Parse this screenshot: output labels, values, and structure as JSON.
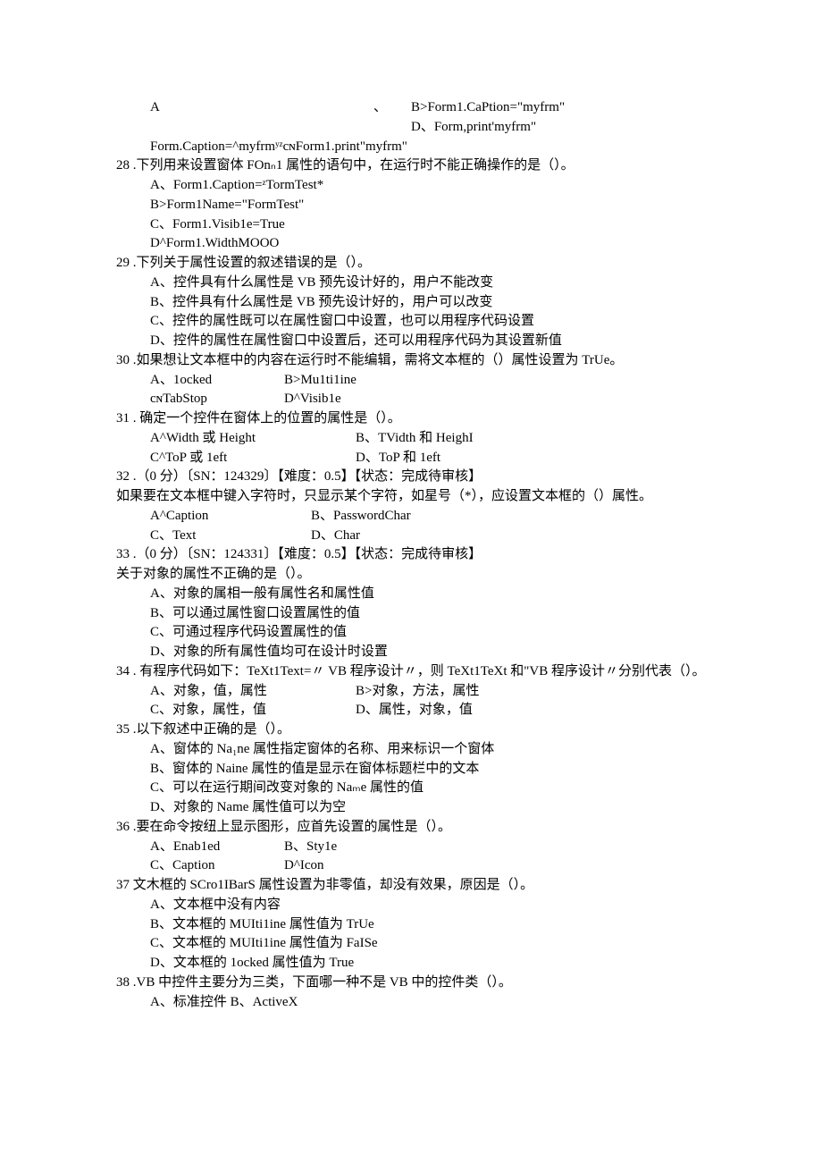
{
  "q27_frag": {
    "A": "A",
    "sep": "、",
    "B": "B>Form1.CaPtion=\"myfrm\"",
    "D": "D、Form,print'myfrm\"",
    "line3": "Form.Caption=^myfrmʸᶻcɴForm1.print\"myfrm\""
  },
  "q28": {
    "num": "28",
    "stem": " .下列用来设置窗体 FOnₙ1 属性的语句中，在运行时不能正确操作的是（）。",
    "A": "A、Form1.Caption=ᶻTormTest*",
    "B": "B>Form1Name=\"FormTest\"",
    "C": "C、Form1.Visib1e=True",
    "D": "D^Form1.WidthMOOO"
  },
  "q29": {
    "num": "29",
    "stem": " .下列关于属性设置的叙述错误的是（）。",
    "A": "A、控件具有什么属性是 VB 预先设计好的，用户不能改变",
    "B": "B、控件具有什么属性是 VB 预先设计好的，用户可以改变",
    "C": "C、控件的属性既可以在属性窗口中设置，也可以用程序代码设置",
    "D": "D、控件的属性在属性窗口中设置后，还可以用程序代码为其设置新值"
  },
  "q30": {
    "num": "30",
    "stem": " .如果想让文本框中的内容在运行时不能编辑，需将文本框的（）属性设置为 TrUe。",
    "A": "A、1ocked",
    "B": "B>Mu1ti1ine",
    "C": "cɴTabStop",
    "D": "D^Visib1e"
  },
  "q31": {
    "num": "31",
    "stem": " . 确定一个控件在窗体上的位置的属性是（）。",
    "A": "A^Width 或 Height",
    "B": "B、TVidth 和 HeighI",
    "C": "C^ToP 或 1eft",
    "D": "D、ToP 和 1eft"
  },
  "q32": {
    "num": "32",
    "stem1": " .（0 分）〔SN：124329〕【难度：0.5】【状态：完成待审核】",
    "stem2": "如果要在文本框中键入字符时，只显示某个字符，如星号（*），应设置文本框的（）属性。",
    "A": "A^Caption",
    "B": "B、PasswordChar",
    "C": "C、Text",
    "D": "D、Char"
  },
  "q33": {
    "num": "33",
    "stem1": " .（0 分）〔SN：124331〕【难度：0.5】【状态：完成待审核】",
    "stem2": "关于对象的属性不正确的是（）。",
    "A": "A、对象的属相一般有属性名和属性值",
    "B": "B、可以通过属性窗口设置属性的值",
    "C": "C、可通过程序代码设置属性的值",
    "D": "D、对象的所有属性值均可在设计时设置"
  },
  "q34": {
    "num": "34",
    "stem": " . 有程序代码如下：TeXt1Text=〃 VB 程序设计〃，则 TeXt1TeXt 和\"VB 程序设计〃分别代表（）。",
    "A": "A、对象，值，属性",
    "B": "B>对象，方法，属性",
    "C": "C、对象，属性，值",
    "D": "D、属性，对象，值"
  },
  "q35": {
    "num": "35",
    "stem": " .以下叙述中正确的是（）。",
    "A": "A、窗体的 Na₁ne 属性指定窗体的名称、用来标识一个窗体",
    "B": "B、窗体的 Naine 属性的值是显示在窗体标题栏中的文本",
    "C": "C、可以在运行期间改变对象的 Naₘe 属性的值",
    "D": "D、对象的 Name 属性值可以为空"
  },
  "q36": {
    "num": "36",
    "stem": " .要在命令按纽上显示图形，应首先设置的属性是（）。",
    "A": "A、Enab1ed",
    "B": "B、Sty1e",
    "C": "C、Caption",
    "D": "D^Icon"
  },
  "q37": {
    "num": "37",
    "stem": " 文木框的 SCro1IBarS 属性设置为非零值，却没有效果，原因是（）。",
    "A": "A、文本框中没有内容",
    "B": "B、文本框的 MUIti1ine 属性值为 TrUe",
    "C": "C、文本框的 MUIti1ine 属性值为 FaISe",
    "D": "D、文本框的 1ocked 属性值为 True"
  },
  "q38": {
    "num": "38",
    "stem": " .VB 中控件主要分为三类，下面哪一种不是 VB 中的控件类（）。",
    "A": "A、标准控件 B、ActiveX"
  }
}
